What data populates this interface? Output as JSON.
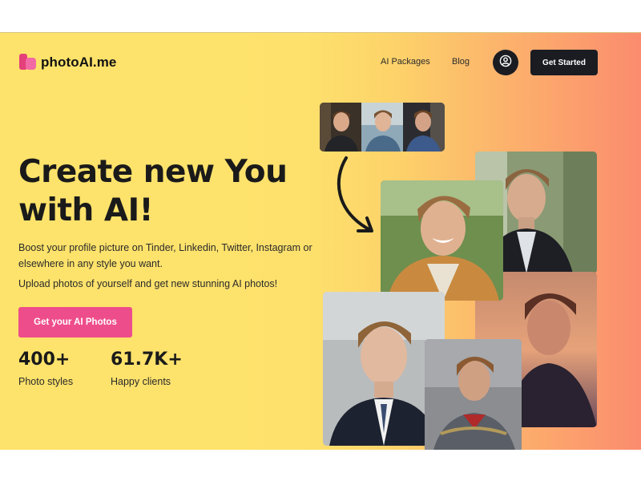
{
  "brand": {
    "name": "photoAI.me",
    "colors": {
      "accent": "#ee4d8b",
      "dark": "#1b1c22",
      "yellow": "#fde36b",
      "orange": "#fb8c6e"
    }
  },
  "nav": {
    "links": [
      {
        "label": "AI Packages"
      },
      {
        "label": "Blog"
      }
    ],
    "account_icon": "user-circle-icon",
    "cta_label": "Get Started"
  },
  "hero": {
    "headline_line1": "Create new You",
    "headline_line2": "with AI!",
    "description_1": "Boost your profile picture on Tinder, Linkedin, Twitter, Instagram or elsewhere in any style you want.",
    "description_2": "Upload photos of yourself and get new stunning AI photos!",
    "cta_label": "Get your AI Photos",
    "stats": [
      {
        "value": "400+",
        "label": "Photo styles"
      },
      {
        "value": "61.7K+",
        "label": "Happy clients"
      }
    ]
  },
  "collage": {
    "input_thumbnails": 3,
    "arrow_icon": "curved-arrow-down-right-icon",
    "generated_photos": 6
  }
}
